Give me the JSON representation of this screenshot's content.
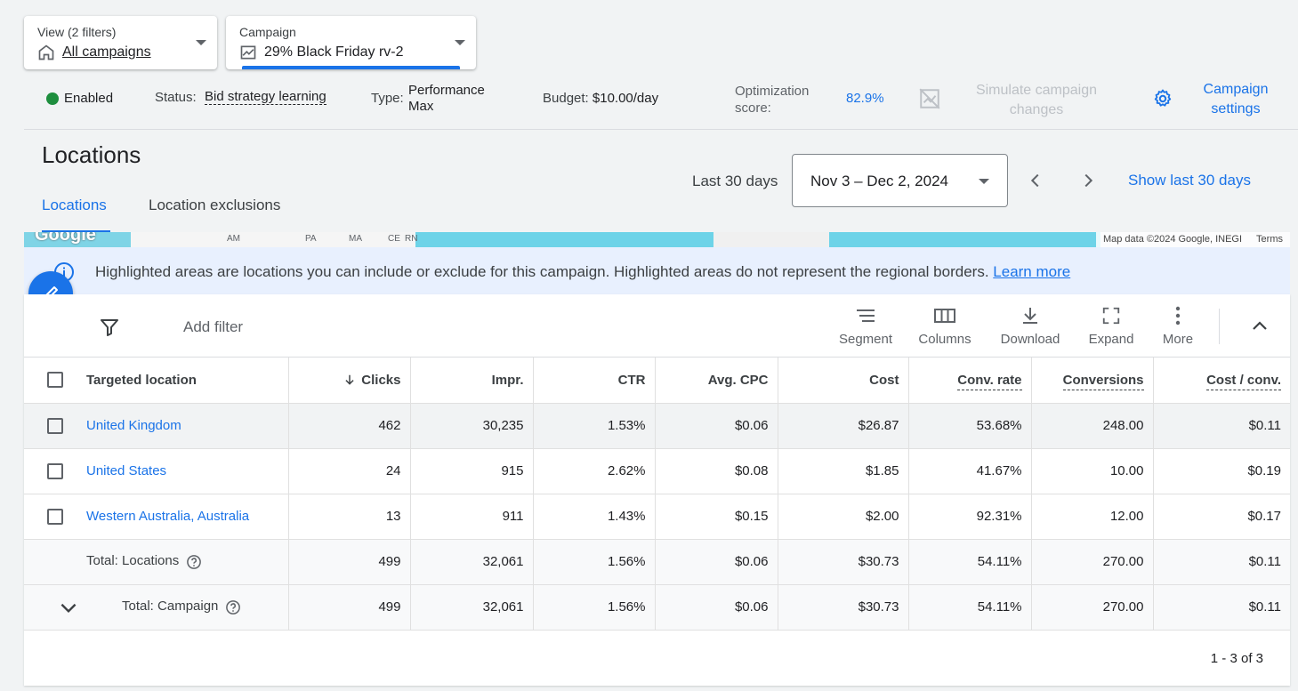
{
  "view_selector": {
    "label": "View (2 filters)",
    "value": "All campaigns"
  },
  "campaign_selector": {
    "label": "Campaign",
    "value": "29% Black Friday rv-2"
  },
  "status_bar": {
    "enabled": "Enabled",
    "status_label": "Status:",
    "status_value": "Bid strategy learning",
    "type_label": "Type:",
    "type_value": "Performance Max",
    "budget_label": "Budget:",
    "budget_value": "$10.00/day",
    "optimization_label": "Optimization score:",
    "optimization_value": "82.9%",
    "simulate": "Simulate campaign changes",
    "campaign_settings": "Campaign settings",
    "enabled_color": "#1e8e3e"
  },
  "page": {
    "title": "Locations",
    "tabs": [
      "Locations",
      "Location exclusions"
    ],
    "active_tab": "Locations"
  },
  "date": {
    "preset": "Last 30 days",
    "range": "Nov 3 – Dec 2, 2024",
    "show_last": "Show last 30 days"
  },
  "map": {
    "logo": "Google",
    "labels": [
      "AM",
      "PA",
      "MA",
      "CE",
      "RN"
    ],
    "attribution": "Map data ©2024 Google, INEGI",
    "terms": "Terms"
  },
  "info_banner": {
    "text": "Highlighted areas are locations you can include or exclude for this campaign. Highlighted areas do not represent the regional borders.",
    "link": "Learn more"
  },
  "toolbar": {
    "add_filter": "Add filter",
    "segment": "Segment",
    "columns": "Columns",
    "download": "Download",
    "expand": "Expand",
    "more": "More"
  },
  "table": {
    "headers": [
      "Targeted location",
      "Clicks",
      "Impr.",
      "CTR",
      "Avg. CPC",
      "Cost",
      "Conv. rate",
      "Conversions",
      "Cost / conv."
    ],
    "rows": [
      {
        "location": "United Kingdom",
        "clicks": "462",
        "impr": "30,235",
        "ctr": "1.53%",
        "cpc": "$0.06",
        "cost": "$26.87",
        "conv_rate": "53.68%",
        "conversions": "248.00",
        "cost_conv": "$0.11"
      },
      {
        "location": "United States",
        "clicks": "24",
        "impr": "915",
        "ctr": "2.62%",
        "cpc": "$0.08",
        "cost": "$1.85",
        "conv_rate": "41.67%",
        "conversions": "10.00",
        "cost_conv": "$0.19"
      },
      {
        "location": "Western Australia, Australia",
        "clicks": "13",
        "impr": "911",
        "ctr": "1.43%",
        "cpc": "$0.15",
        "cost": "$2.00",
        "conv_rate": "92.31%",
        "conversions": "12.00",
        "cost_conv": "$0.17"
      }
    ],
    "totals": [
      {
        "label": "Total: Locations",
        "clicks": "499",
        "impr": "32,061",
        "ctr": "1.56%",
        "cpc": "$0.06",
        "cost": "$30.73",
        "conv_rate": "54.11%",
        "conversions": "270.00",
        "cost_conv": "$0.11"
      },
      {
        "label": "Total: Campaign",
        "clicks": "499",
        "impr": "32,061",
        "ctr": "1.56%",
        "cpc": "$0.06",
        "cost": "$30.73",
        "conv_rate": "54.11%",
        "conversions": "270.00",
        "cost_conv": "$0.11"
      }
    ],
    "pagination": "1 - 3 of 3"
  }
}
